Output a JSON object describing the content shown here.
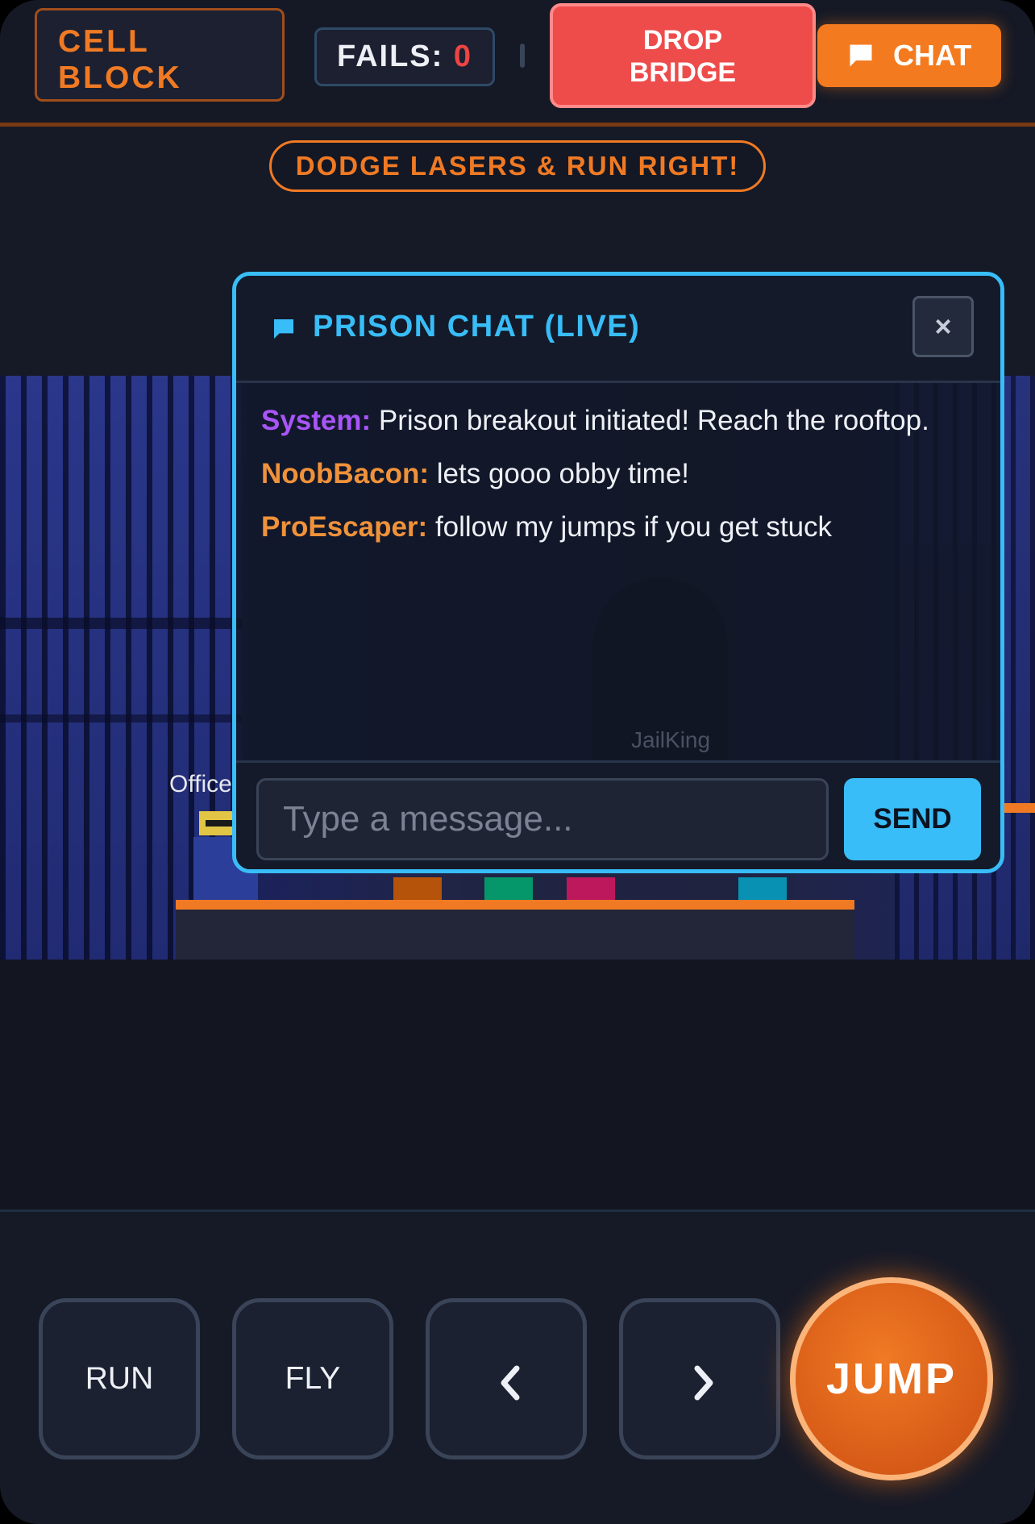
{
  "header": {
    "level_line1": "CELL",
    "level_line2": "BLOCK",
    "fails_label": "FAILS:",
    "fails_count": "0",
    "drop_bridge_label": "DROP\nBRIDGE",
    "chat_button_label": "CHAT"
  },
  "hint": "DODGE LASERS & RUN RIGHT!",
  "world": {
    "npc_label": "Office",
    "background_player_name": "JailKing",
    "laser_colors": [
      "#b45309",
      "#059669",
      "#be185d",
      "#0891b2"
    ]
  },
  "chat": {
    "title": "PRISON CHAT (LIVE)",
    "close_label": "×",
    "messages": [
      {
        "user": "System:",
        "text": " Prison breakout initiated! Reach the rooftop.",
        "color": "#a855f7"
      },
      {
        "user": "NoobBacon:",
        "text": " lets gooo obby time!",
        "color": "#f0923a"
      },
      {
        "user": "ProEscaper:",
        "text": " follow my jumps if you get stuck",
        "color": "#f0923a"
      }
    ],
    "input_placeholder": "Type a message...",
    "input_value": "",
    "send_label": "SEND"
  },
  "controls": {
    "run_label": "RUN",
    "fly_label": "FLY",
    "left_icon": "chevron-left-icon",
    "right_icon": "chevron-right-icon",
    "jump_label": "JUMP"
  },
  "colors": {
    "accent_orange": "#f07a24",
    "accent_blue": "#38bdf8",
    "danger_red": "#ee4b4b"
  }
}
